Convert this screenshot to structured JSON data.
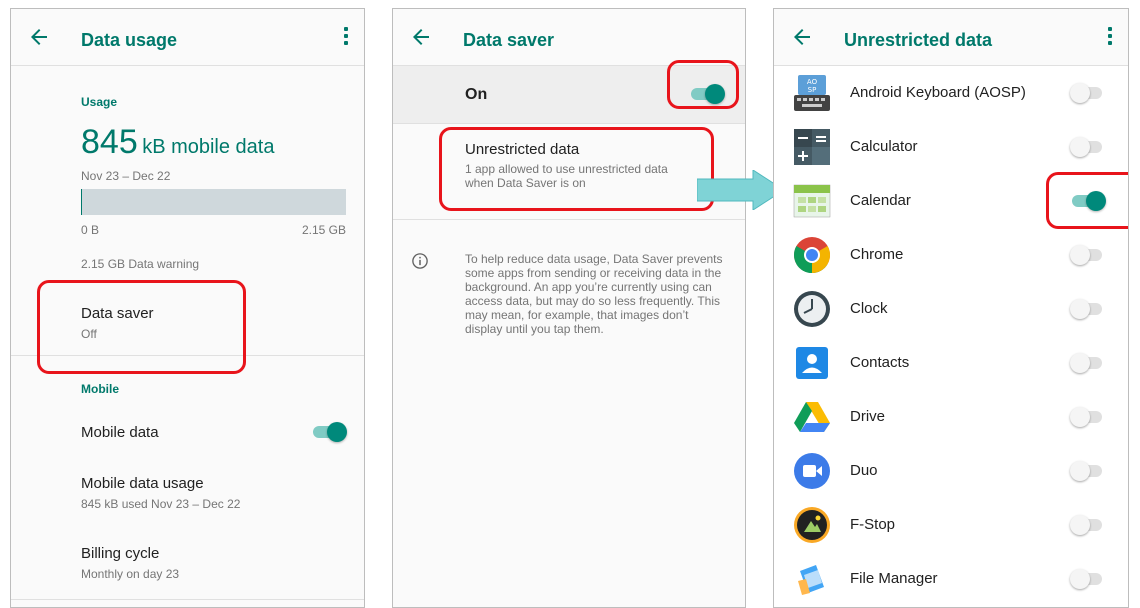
{
  "screen1": {
    "title": "Data usage",
    "usage_label": "Usage",
    "usage_amount": "845",
    "usage_unit": "kB mobile data",
    "period": "Nov 23 – Dec 22",
    "bar_min": "0 B",
    "bar_max": "2.15 GB",
    "bar_fill_fraction": 0.0004,
    "warning": "2.15 GB Data warning",
    "data_saver_title": "Data saver",
    "data_saver_value": "Off",
    "mobile_label": "Mobile",
    "mobile_data_title": "Mobile data",
    "mobile_data_on": true,
    "mobile_usage_title": "Mobile data usage",
    "mobile_usage_sub": "845 kB used Nov 23 – Dec 22",
    "billing_title": "Billing cycle",
    "billing_sub": "Monthly on day 23"
  },
  "screen2": {
    "title": "Data saver",
    "master_label": "On",
    "master_on": true,
    "unrestricted_title": "Unrestricted data",
    "unrestricted_sub_1": "1 app allowed to use unrestricted data",
    "unrestricted_sub_2": "when Data Saver is on",
    "info_text": "To help reduce data usage, Data Saver prevents some apps from sending or receiving data in the background. An app you’re currently using can access data, but may do so less frequently. This may mean, for example, that images don’t display until you tap them."
  },
  "screen3": {
    "title": "Unrestricted data",
    "apps": [
      {
        "name": "Android Keyboard (AOSP)",
        "icon": "keyboard-icon",
        "on": false
      },
      {
        "name": "Calculator",
        "icon": "calculator-icon",
        "on": false
      },
      {
        "name": "Calendar",
        "icon": "calendar-icon",
        "on": true
      },
      {
        "name": "Chrome",
        "icon": "chrome-icon",
        "on": false
      },
      {
        "name": "Clock",
        "icon": "clock-icon",
        "on": false
      },
      {
        "name": "Contacts",
        "icon": "contacts-icon",
        "on": false
      },
      {
        "name": "Drive",
        "icon": "drive-icon",
        "on": false
      },
      {
        "name": "Duo",
        "icon": "duo-icon",
        "on": false
      },
      {
        "name": "F-Stop",
        "icon": "fstop-icon",
        "on": false
      },
      {
        "name": "File Manager",
        "icon": "file-manager-icon",
        "on": false
      }
    ]
  },
  "colors": {
    "accent": "#00796b",
    "toggle_on": "#00897b",
    "highlight": "#e8141b",
    "arrow": "#7fd3d6"
  }
}
